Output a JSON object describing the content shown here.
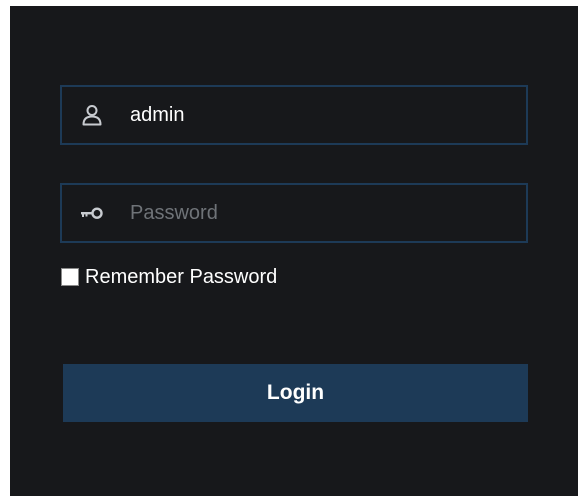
{
  "login_form": {
    "username": {
      "icon": "user-icon",
      "value": "admin",
      "placeholder": ""
    },
    "password": {
      "icon": "key-icon",
      "value": "",
      "placeholder": "Password"
    },
    "remember": {
      "label": "Remember Password",
      "checked": false
    },
    "login_label": "Login"
  },
  "colors": {
    "panel_background": "#17181b",
    "field_border": "#1d3a57",
    "button_background": "#1d3a57",
    "text": "#ffffff",
    "placeholder": "#6f7378"
  }
}
